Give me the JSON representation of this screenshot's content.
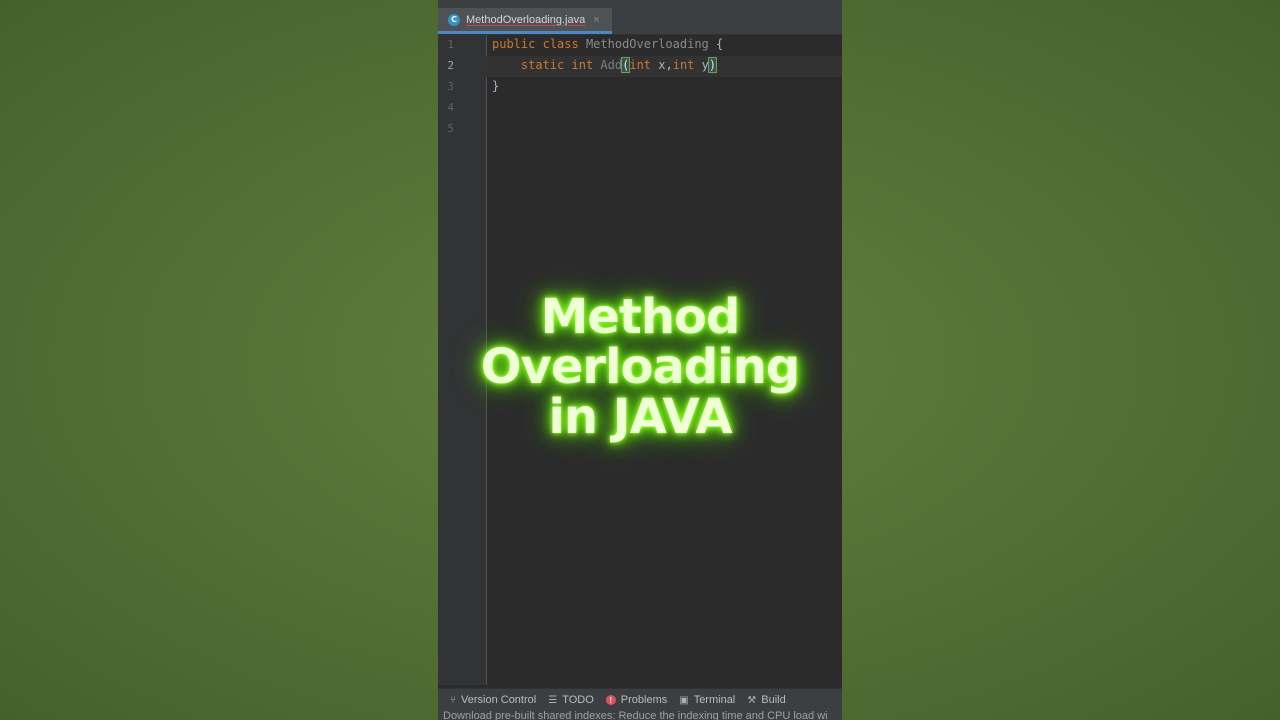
{
  "editor": {
    "tab": {
      "icon": "java-class-icon",
      "icon_glyph": "C",
      "label": "MethodOverloading.java",
      "close": "×"
    },
    "line_numbers": [
      "1",
      "2",
      "3",
      "4",
      "5"
    ],
    "code": {
      "l1_kw1": "public",
      "l1_kw2": "class",
      "l1_name": "MethodOverloading",
      "l1_brace": "{",
      "l2_kw1": "static",
      "l2_kw2": "int",
      "l2_name": "Add",
      "l2_open": "(",
      "l2_kw3": "int",
      "l2_p1": "x,",
      "l2_kw4": "int",
      "l2_p2": "y",
      "l2_close": ")",
      "l3_brace": "}"
    }
  },
  "overlay": {
    "line1": "Method",
    "line2": "Overloading",
    "line3": "in JAVA",
    "glow_color": "#7dff1a"
  },
  "toolwindows": [
    {
      "icon": "version-control-icon",
      "label": "Version Control"
    },
    {
      "icon": "todo-icon",
      "label": "TODO"
    },
    {
      "icon": "problems-icon",
      "label": "Problems"
    },
    {
      "icon": "terminal-icon",
      "label": "Terminal"
    },
    {
      "icon": "build-icon",
      "label": "Build"
    }
  ],
  "status": {
    "message": "Download pre-built shared indexes: Reduce the indexing time and CPU load wi"
  }
}
